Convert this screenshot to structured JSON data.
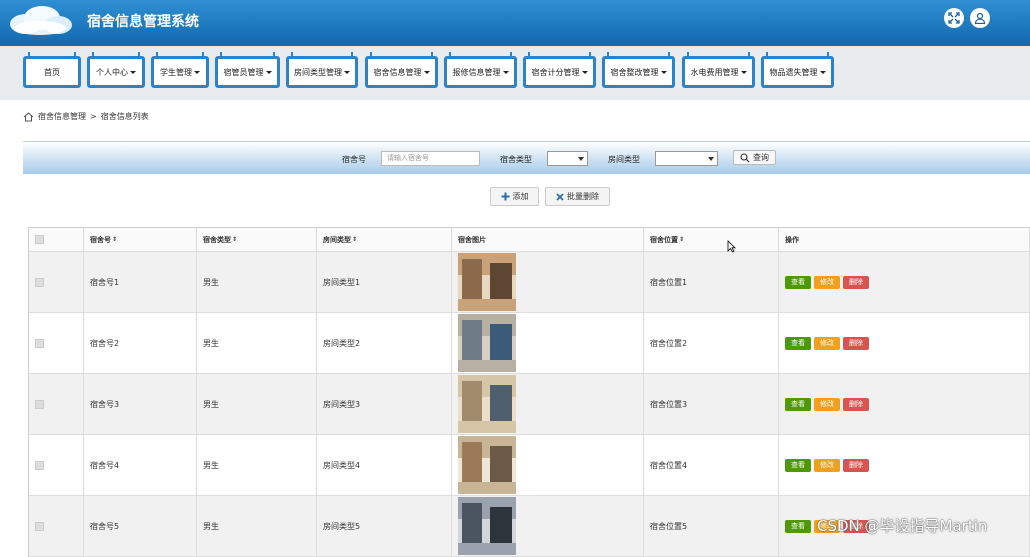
{
  "header": {
    "title": "宿舍信息管理系统",
    "icons": [
      "fullscreen-icon",
      "user-icon"
    ]
  },
  "nav": {
    "tabs": [
      {
        "label": "首页",
        "dropdown": false
      },
      {
        "label": "个人中心",
        "dropdown": true
      },
      {
        "label": "学生管理",
        "dropdown": true
      },
      {
        "label": "宿管员管理",
        "dropdown": true
      },
      {
        "label": "房间类型管理",
        "dropdown": true
      },
      {
        "label": "宿舍信息管理",
        "dropdown": true
      },
      {
        "label": "报修信息管理",
        "dropdown": true
      },
      {
        "label": "宿舍计分管理",
        "dropdown": true
      },
      {
        "label": "宿舍整改管理",
        "dropdown": true
      },
      {
        "label": "水电费用管理",
        "dropdown": true
      },
      {
        "label": "物品遗失管理",
        "dropdown": true
      }
    ]
  },
  "breadcrumb": {
    "parent": "宿舍信息管理",
    "separator": ">",
    "current": "宿舍信息列表"
  },
  "search": {
    "dorm_no_label": "宿舍号",
    "dorm_no_placeholder": "请输入宿舍号",
    "dorm_type_label": "宿舍类型",
    "room_type_label": "房间类型",
    "query_label": "查询"
  },
  "actions": {
    "add_label": "添加",
    "batch_delete_label": "批量删除"
  },
  "table": {
    "columns": [
      "宿舍号",
      "宿舍类型",
      "房间类型",
      "宿舍图片",
      "宿舍位置",
      "操作"
    ],
    "rows": [
      {
        "dorm_no": "宿舍号1",
        "dorm_type": "男生",
        "room_type": "房间类型1",
        "location": "宿舍位置1"
      },
      {
        "dorm_no": "宿舍号2",
        "dorm_type": "男生",
        "room_type": "房间类型2",
        "location": "宿舍位置2"
      },
      {
        "dorm_no": "宿舍号3",
        "dorm_type": "男生",
        "room_type": "房间类型3",
        "location": "宿舍位置3"
      },
      {
        "dorm_no": "宿舍号4",
        "dorm_type": "男生",
        "room_type": "房间类型4",
        "location": "宿舍位置4"
      },
      {
        "dorm_no": "宿舍号5",
        "dorm_type": "男生",
        "room_type": "房间类型5",
        "location": "宿舍位置5"
      }
    ],
    "row_actions": {
      "view": "查看",
      "edit": "修改",
      "delete": "删除"
    }
  },
  "watermark": "CSDN @毕设指导Martin",
  "colors": {
    "header": "#1a77c0",
    "tab_border": "#2c83c9",
    "view": "#4e9a06",
    "edit": "#f0a01c",
    "delete": "#d9534f"
  }
}
